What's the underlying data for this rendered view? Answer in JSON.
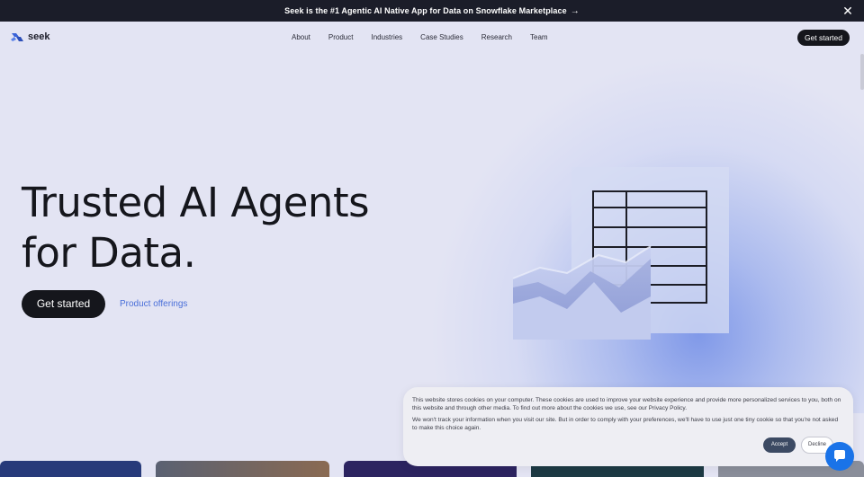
{
  "announcement": {
    "text": "Seek is the #1 Agentic AI Native App for Data on Snowflake Marketplace",
    "arrow": "→",
    "close": "✕"
  },
  "nav": {
    "logo_text": "seek",
    "items": [
      "About",
      "Product",
      "Industries",
      "Case Studies",
      "Research",
      "Team"
    ],
    "cta": "Get started"
  },
  "hero": {
    "title_line1": "Trusted AI Agents",
    "title_line2": "for Data.",
    "cta": "Get started",
    "link": "Product offerings"
  },
  "cookie": {
    "text1": "This website stores cookies on your computer. These cookies are used to improve your website experience and provide more personalized services to you, both on this website and through other media. To find out more about the cookies we use, see our Privacy Policy.",
    "text2": "We won't track your information when you visit our site. But in order to comply with your preferences, we'll have to use just one tiny cookie so that you're not asked to make this choice again.",
    "accept": "Accept",
    "decline": "Decline"
  },
  "colors": {
    "background": "#e3e4f3",
    "dark": "#15161c",
    "link": "#4a6fd9",
    "chat": "#1a73e8"
  },
  "icons": {
    "logo": "seek-logo-icon",
    "chat": "chat-bubble-icon"
  }
}
